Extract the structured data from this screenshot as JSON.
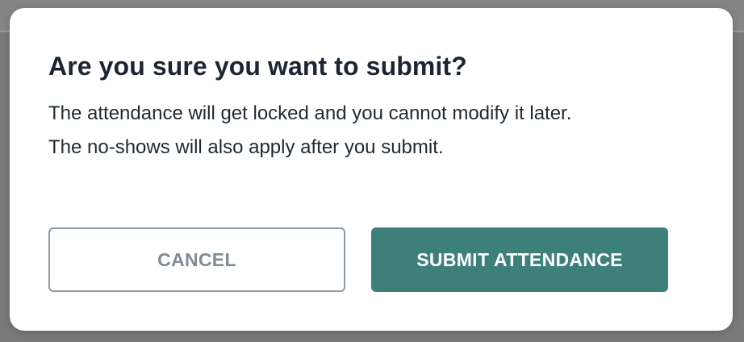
{
  "dialog": {
    "title": "Are you sure you want to submit?",
    "body_lines": [
      "The attendance will get locked and you cannot modify it later.",
      "The no-shows will also apply after you submit."
    ],
    "buttons": {
      "cancel_label": "CANCEL",
      "submit_label": "SUBMIT ATTENDANCE"
    }
  },
  "colors": {
    "overlay": "#7a7a7a",
    "dialog_background": "#ffffff",
    "title_text": "#1c2632",
    "cancel_border": "#8e9aa6",
    "cancel_text": "#7f8b96",
    "submit_background": "#3d8079",
    "submit_text": "#ffffff"
  }
}
